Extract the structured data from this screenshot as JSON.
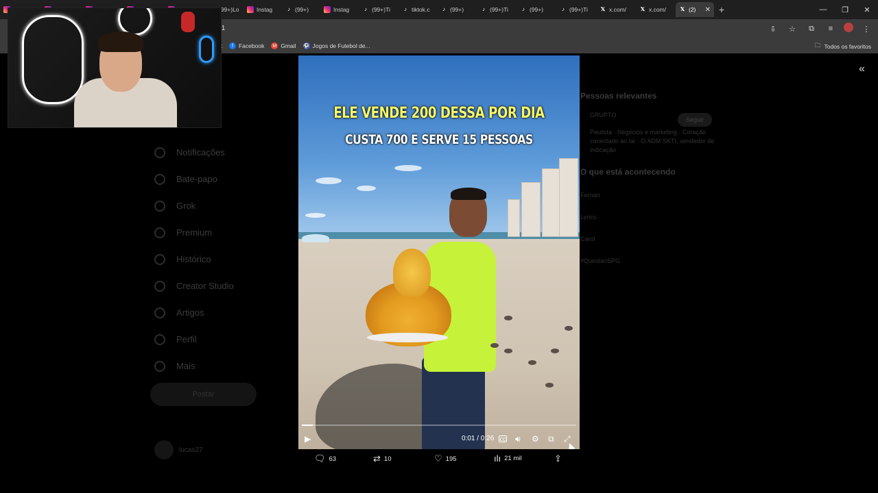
{
  "browser": {
    "tabs": [
      {
        "icon": "instagram-icon",
        "label": "Instag"
      },
      {
        "icon": "instagram-icon",
        "label": "Instag"
      },
      {
        "icon": "instagram-icon",
        "label": "Instag"
      },
      {
        "icon": "tiktok-icon",
        "label": "(99+)"
      },
      {
        "icon": "instagram-icon",
        "label": "Instag"
      },
      {
        "icon": "tiktok-icon",
        "label": "(99+)Ti"
      },
      {
        "icon": "tiktok-icon",
        "label": "tiktok.c"
      },
      {
        "icon": "tiktok-icon",
        "label": "(99+)"
      },
      {
        "icon": "tiktok-icon",
        "label": "(99+)Ti"
      },
      {
        "icon": "tiktok-icon",
        "label": "(99+)"
      },
      {
        "icon": "tiktok-icon",
        "label": "(99+)Ti"
      },
      {
        "icon": "x-icon",
        "label": "x.com/"
      },
      {
        "icon": "x-icon",
        "label": "x.com/"
      }
    ],
    "lead_tab_label": "(99+)Lo",
    "active_tab": {
      "icon": "x-icon",
      "label": "(2)"
    },
    "url_fragment": "/1",
    "bookmarks": [
      {
        "icon": "facebook-icon",
        "label": "Facebook",
        "color": "#1877f2"
      },
      {
        "icon": "gmail-icon",
        "label": "Gmail",
        "color": "#ea4335"
      },
      {
        "icon": "game-icon",
        "label": "Jogos de Futebol de...",
        "color": "#3b5bdb"
      }
    ],
    "bookmark_partial": "ok",
    "all_bookmarks_label": "Todos os favoritos"
  },
  "video": {
    "caption_line1": "ELE VENDE 200 DESSA POR DIA",
    "caption_line2": "CUSTA 700 E SERVE 15 PESSOAS",
    "time_display": "0:01 / 0:26",
    "progress": 0.04
  },
  "actions": {
    "replies": "63",
    "reposts": "10",
    "likes": "195",
    "views": "21 mil"
  },
  "background_page": {
    "sidebar": [
      "Notificações",
      "Bate-papo",
      "Grok",
      "Premium",
      "Histórico",
      "Creator Studio",
      "Artigos",
      "Perfil",
      "Mais"
    ],
    "post_button": "Postar",
    "profile_name": "lucas27",
    "right_heading1": "Pessoas relevantes",
    "right_user": "GRUPTO",
    "follow_label": "Seguir",
    "right_bio": "Paulista · Negócios e marketing · Coração conectado ao lar · O ADM SKTI, vendedor de indicação",
    "right_heading2": "O que está acontecendo",
    "trends": [
      "Fernan",
      "Lyrics",
      "Carol",
      "#QuestanSPG"
    ]
  }
}
